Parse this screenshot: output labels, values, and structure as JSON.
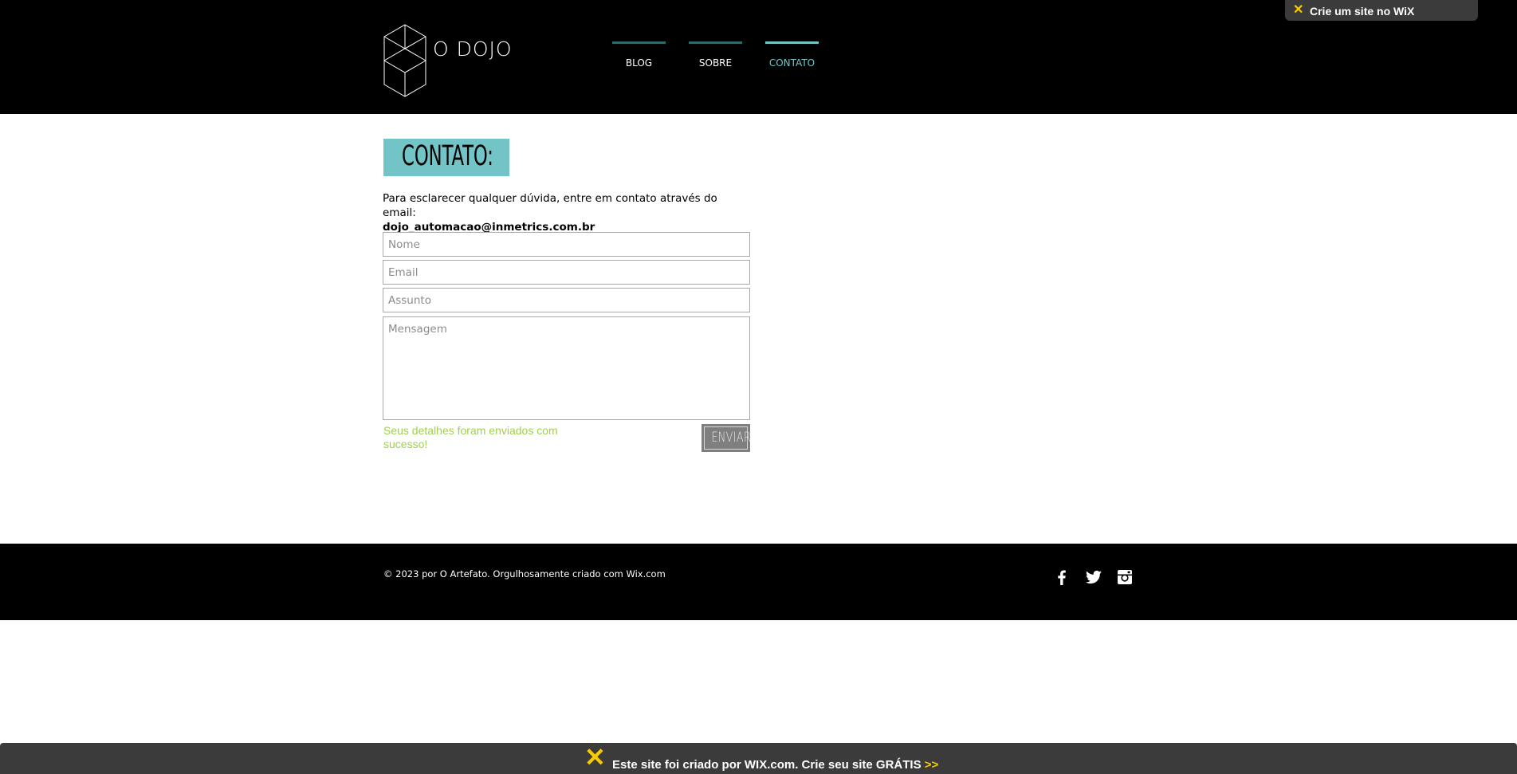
{
  "header": {
    "logo_text": "O DOJO",
    "nav": [
      {
        "label": "BLOG",
        "active": false
      },
      {
        "label": "SOBRE",
        "active": false
      },
      {
        "label": "CONTATO",
        "active": true
      }
    ]
  },
  "wix_top_badge": {
    "icon": "wix-x-icon",
    "text": "Crie um site no WiX"
  },
  "contact": {
    "title": "CONTATO:",
    "intro": "Para esclarecer qualquer dúvida, entre em contato através do email:",
    "email": "dojo_automacao@inmetrics.com.br",
    "fields": {
      "name_placeholder": "Nome",
      "email_placeholder": "Email",
      "subject_placeholder": "Assunto",
      "message_placeholder": "Mensagem"
    },
    "success_message": "Seus detalhes foram enviados com sucesso!",
    "send_label": "ENVIAR"
  },
  "footer": {
    "copyright": "© 2023 por O Artefato. Orgulhosamente criado com Wix.com",
    "social": [
      "facebook-icon",
      "twitter-icon",
      "instagram-icon"
    ]
  },
  "wix_bottom_banner": {
    "icon": "wix-x-icon",
    "text": "Este site foi criado por WIX.com. Crie seu site GRÁTIS",
    "arrows": ">>"
  },
  "colors": {
    "accent": "#72c4c6",
    "nav_inactive_bar": "#2f6a69",
    "success": "#9fd14a",
    "wix_yellow": "#f7cb00",
    "wix_bar": "#3b3b3b"
  }
}
